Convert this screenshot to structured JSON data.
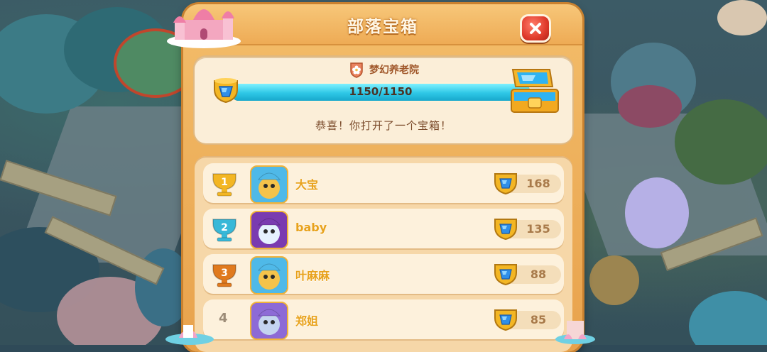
{
  "dialog": {
    "title": "部落宝箱",
    "close_icon": "close-icon"
  },
  "tribe": {
    "name": "梦幻养老院",
    "badge_icon": "flower-badge-icon"
  },
  "progress": {
    "text": "1150/1150",
    "current": 1150,
    "max": 1150,
    "fraction": 1.0,
    "cup_icon": "gem-trophy-icon",
    "chest_icon": "treasure-chest-icon"
  },
  "message": "恭喜！你打开了一个宝箱！",
  "ranking": [
    {
      "rank": "1",
      "rank_style": "gold-trophy",
      "name": "大宝",
      "score": "168",
      "avatar": "cat-avatar"
    },
    {
      "rank": "2",
      "rank_style": "silver-trophy",
      "name": "baby",
      "score": "135",
      "avatar": "wizard-avatar"
    },
    {
      "rank": "3",
      "rank_style": "bronze-trophy",
      "name": "叶麻麻",
      "score": "88",
      "avatar": "cat-avatar"
    },
    {
      "rank": "4",
      "rank_style": "plain",
      "name": "郑姐",
      "score": "85",
      "avatar": "purple-hair-avatar"
    }
  ],
  "colors": {
    "panel": "#f3bd6a",
    "bar_fill": "#2ec7e6",
    "gold": "#f3b623",
    "silver": "#38b8d8",
    "bronze": "#e07a1e",
    "close_red": "#e03b2c"
  }
}
